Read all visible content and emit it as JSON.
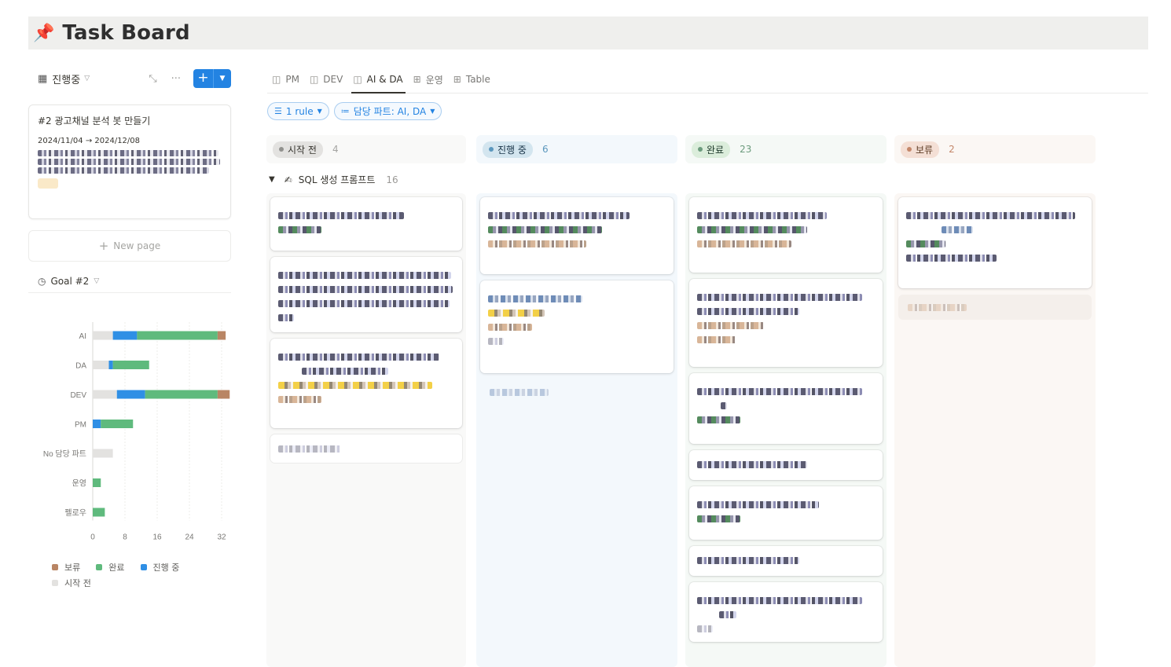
{
  "page": {
    "icon": "pushpin-icon",
    "title": "Task Board"
  },
  "left_panel": {
    "view_name": "진행중",
    "view_icon": "board-icon",
    "card": {
      "title": "#2 광고채널 분석 봇 만들기",
      "dates": "2024/11/04 → 2024/12/08"
    },
    "new_page_label": "New page",
    "goal_view": "Goal #2"
  },
  "chart_data": {
    "type": "bar",
    "orientation": "horizontal",
    "stacked": true,
    "categories": [
      "AI",
      "DA",
      "DEV",
      "PM",
      "No 담당 파트",
      "운영",
      "펠로우"
    ],
    "series": [
      {
        "name": "시작 전",
        "color": "#e3e2e0",
        "values": [
          5,
          4,
          6,
          0,
          5,
          0,
          0
        ]
      },
      {
        "name": "진행 중",
        "color": "#2f8fe5",
        "values": [
          6,
          1,
          7,
          2,
          0,
          0,
          0
        ]
      },
      {
        "name": "완료",
        "color": "#5fba7d",
        "values": [
          20,
          9,
          18,
          8,
          0,
          2,
          3
        ]
      },
      {
        "name": "보류",
        "color": "#b98564",
        "values": [
          2,
          0,
          3,
          0,
          0,
          0,
          0
        ]
      }
    ],
    "xlim": [
      0,
      32
    ],
    "xticks": [
      "0",
      "8",
      "16",
      "24",
      "32"
    ],
    "grid": true,
    "legend_position": "bottom-left",
    "legend_order": [
      "보류",
      "완료",
      "진행 중",
      "시작 전"
    ]
  },
  "tabs": [
    {
      "label": "PM",
      "icon": "board-icon"
    },
    {
      "label": "DEV",
      "icon": "board-icon"
    },
    {
      "label": "AI & DA",
      "icon": "board-icon",
      "active": true
    },
    {
      "label": "운영",
      "icon": "table-icon"
    },
    {
      "label": "Table",
      "icon": "table-icon"
    }
  ],
  "filters": {
    "rule": "1 rule",
    "part": "담당 파트: AI, DA"
  },
  "columns": [
    {
      "label": "시작 전",
      "count": "4",
      "bg": "#f9f9f8",
      "pill_bg": "#e3e2e0",
      "dot": "#91918e",
      "text": "#37352f",
      "count_color": "#a5a5a2"
    },
    {
      "label": "진행 중",
      "count": "6",
      "bg": "#f3f8fc",
      "pill_bg": "#d3e5ef",
      "dot": "#5b97bd",
      "text": "#183347",
      "count_color": "#5b97bd"
    },
    {
      "label": "완료",
      "count": "23",
      "bg": "#f5f9f6",
      "pill_bg": "#dbeddb",
      "dot": "#6c9b7d",
      "text": "#1c3829",
      "count_color": "#6c9b7d"
    },
    {
      "label": "보류",
      "count": "2",
      "bg": "#fbf7f4",
      "pill_bg": "#f4dfd5",
      "dot": "#c4876a",
      "text": "#5c3b23",
      "count_color": "#c4876a"
    }
  ],
  "group": {
    "label": "SQL 생성 프롬프트",
    "count": "16",
    "emoji": "✍"
  }
}
